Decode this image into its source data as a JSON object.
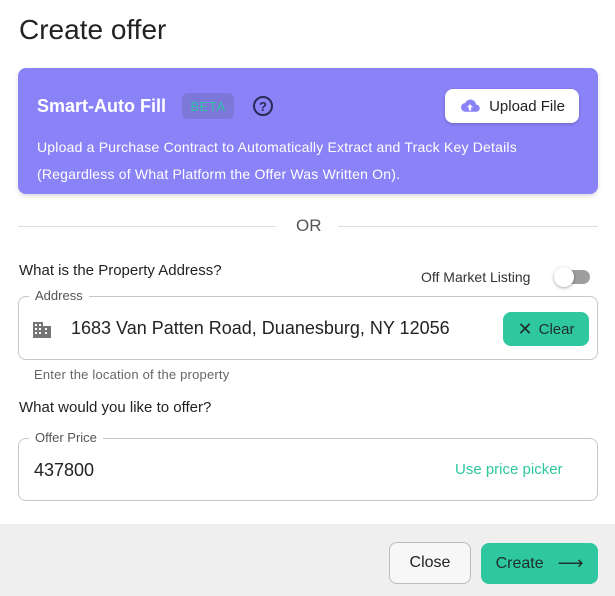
{
  "dialog": {
    "title": "Create offer"
  },
  "smart_fill": {
    "title": "Smart-Auto Fill",
    "badge": "BETA",
    "help_icon": "question-circle-icon",
    "upload_label": "Upload File",
    "upload_icon": "cloud-upload-icon",
    "description": "Upload a Purchase Contract to Automatically Extract and Track Key Details (Regardless of What Platform the Offer Was Written On).",
    "background_color": "#8a82f7"
  },
  "divider": {
    "text": "OR"
  },
  "address_section": {
    "question": "What is the Property Address?",
    "off_market_label": "Off Market Listing",
    "off_market_enabled": false,
    "field_label": "Address",
    "field_icon": "building-icon",
    "value": "1683 Van Patten Road, Duanesburg, NY 12056",
    "clear_label": "Clear",
    "helper_text": "Enter the location of the property"
  },
  "offer_section": {
    "question": "What would you like to offer?",
    "field_label": "Offer Price",
    "value": "437800",
    "price_picker_label": "Use price picker"
  },
  "footer": {
    "close_label": "Close",
    "create_label": "Create",
    "create_icon": "arrow-right-icon",
    "accent_color": "#2ec79f"
  }
}
